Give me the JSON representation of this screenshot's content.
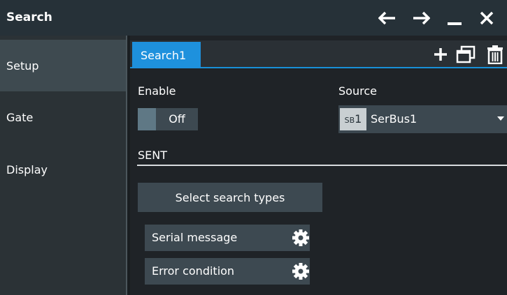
{
  "window": {
    "title": "Search",
    "controls": [
      "back-arrow-icon",
      "forward-arrow-icon",
      "minimize-icon",
      "close-icon"
    ]
  },
  "sidebar": {
    "items": [
      {
        "label": "Setup",
        "active": true
      },
      {
        "label": "Gate",
        "active": false
      },
      {
        "label": "Display",
        "active": false
      }
    ]
  },
  "tabs": {
    "active_label": "Search1",
    "actions": [
      "add-icon",
      "copy-icon",
      "delete-icon"
    ]
  },
  "enable": {
    "label": "Enable",
    "value": "Off"
  },
  "source": {
    "label": "Source",
    "badge_prefix": "SB",
    "badge_number": "1",
    "value": "SerBus1"
  },
  "section": {
    "title": "SENT"
  },
  "search_types": {
    "button_label": "Select search types",
    "items": [
      {
        "label": "Serial message"
      },
      {
        "label": "Error condition"
      }
    ]
  },
  "colors": {
    "accent": "#1e91dd",
    "title_bar": "#263138",
    "sidebar": "#2b3236",
    "sidebar_active": "#3e4a50",
    "background": "#1f2327",
    "control": "#3d4951"
  }
}
